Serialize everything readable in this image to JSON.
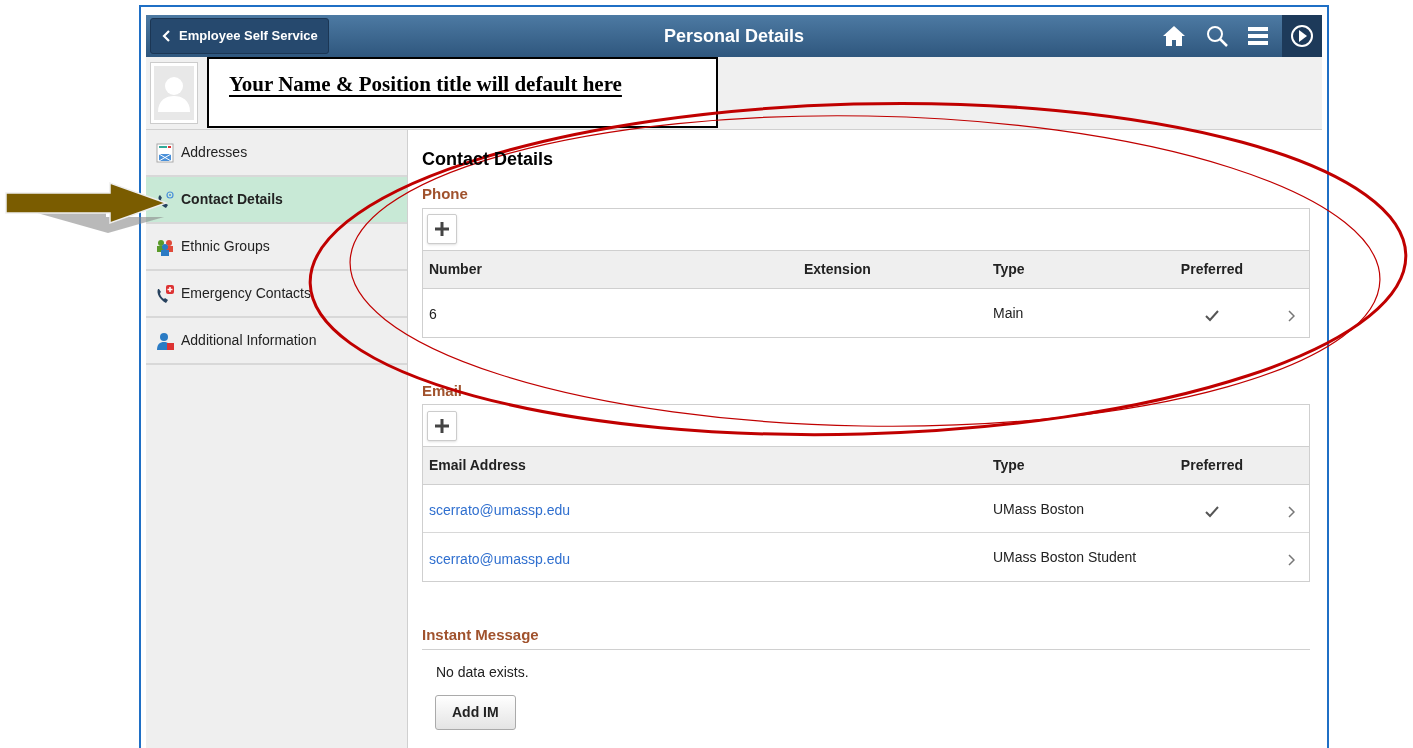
{
  "header": {
    "back_button": "Employee Self Service",
    "title": "Personal Details"
  },
  "callout": {
    "text": "Your Name & Position title will default here"
  },
  "sidebar": {
    "items": [
      {
        "label": "Addresses",
        "selected": false
      },
      {
        "label": "Contact Details",
        "selected": true
      },
      {
        "label": "Ethnic Groups",
        "selected": false
      },
      {
        "label": "Emergency Contacts",
        "selected": false
      },
      {
        "label": "Additional Information",
        "selected": false
      }
    ]
  },
  "content": {
    "title": "Contact Details",
    "phone": {
      "heading": "Phone",
      "columns": [
        "Number",
        "Extension",
        "Type",
        "Preferred"
      ],
      "rows": [
        {
          "cells": [
            "6",
            "",
            "Main"
          ],
          "preferred": true
        }
      ]
    },
    "email": {
      "heading": "Email",
      "columns": [
        "Email Address",
        "Type",
        "Preferred"
      ],
      "rows": [
        {
          "cells": [
            "scerrato@umassp.edu",
            "UMass Boston"
          ],
          "preferred": true
        },
        {
          "cells": [
            "scerrato@umassp.edu",
            "UMass Boston Student"
          ],
          "preferred": false
        }
      ]
    },
    "instant_message": {
      "heading": "Instant Message",
      "empty_text": "No data exists.",
      "button": "Add IM"
    }
  }
}
